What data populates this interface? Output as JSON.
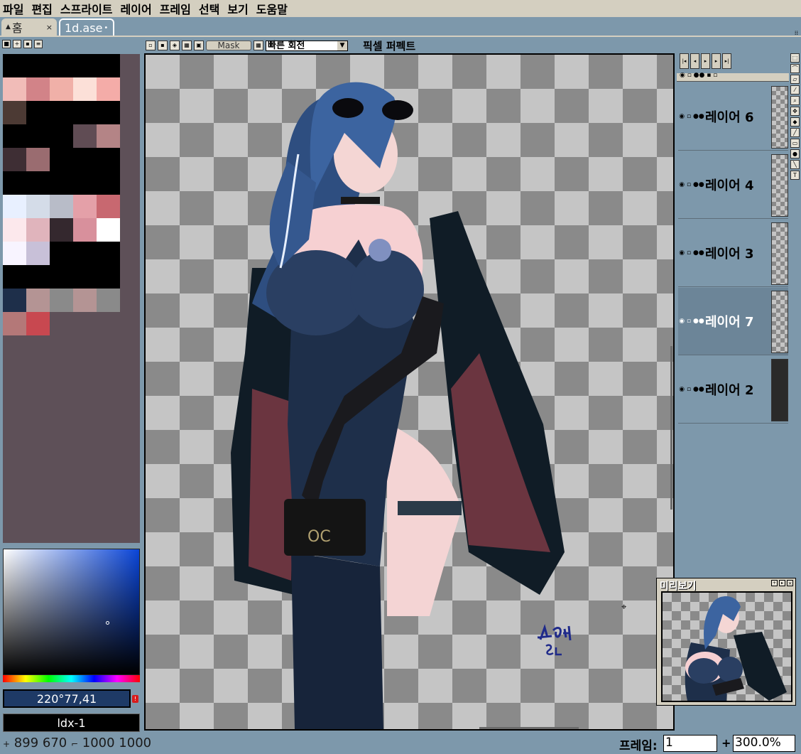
{
  "menu": [
    "파일",
    "편집",
    "스프라이트",
    "레이어",
    "프레임",
    "선택",
    "보기",
    "도움말"
  ],
  "tabs": {
    "home": "홈",
    "file": "1d.ase"
  },
  "toolbar": {
    "mask_label": "Mask",
    "rotation_value": "빠른 회전",
    "pixel_perfect": "픽셀 퍼펙트"
  },
  "palette": {
    "colors": [
      [
        "#000000",
        "#000000",
        "#000000",
        "#000000",
        "#000000"
      ],
      [
        "#f1bcb8",
        "#d28388",
        "#f0b0a8",
        "#fce0d8",
        "#f4aca8"
      ],
      [
        "#4c3a34",
        "#000000",
        "#000000",
        "#000000",
        "#000000"
      ],
      [
        "#000000",
        "#000000",
        "#000000",
        "#604c54",
        "#b48486"
      ],
      [
        "#3e2e34",
        "#9a6c70",
        "#000000",
        "#000000",
        "#000000"
      ],
      [
        "#000000",
        "#000000",
        "#000000",
        "#000000",
        "#000000"
      ],
      [
        "#e8f0ff",
        "#d4dce8",
        "#b8bcc8",
        "#e4a0a8",
        "#c86870"
      ],
      [
        "#fce8ec",
        "#e0b4bc",
        "#34282e",
        "#d8909c",
        "#ffffff"
      ],
      [
        "#f8f4ff",
        "#c8c0d8",
        "#000000",
        "#000000",
        "#000000"
      ],
      [
        "#000000",
        "#000000",
        "#000000",
        "#000000",
        "#000000"
      ],
      [
        "#1e2f4a",
        "#b49494",
        "#8a8a8a",
        "#b49494",
        "#8a8a8a"
      ],
      [
        "#b47878",
        "#c84850"
      ]
    ]
  },
  "color": {
    "hsv_text": "220°77,41",
    "index_text": "ldx-1"
  },
  "layers": [
    {
      "name": "레이어 6",
      "selected": false
    },
    {
      "name": "레이어 4",
      "selected": false
    },
    {
      "name": "레이어 3",
      "selected": false
    },
    {
      "name": "레이어 7",
      "selected": true
    },
    {
      "name": "레이어 2",
      "selected": false
    }
  ],
  "preview": {
    "title": "미리보기"
  },
  "status": {
    "coords": "899 670",
    "size": "1000 1000",
    "frame_label": "프레임:",
    "frame_value": "1",
    "zoom_value": "300.0%"
  }
}
